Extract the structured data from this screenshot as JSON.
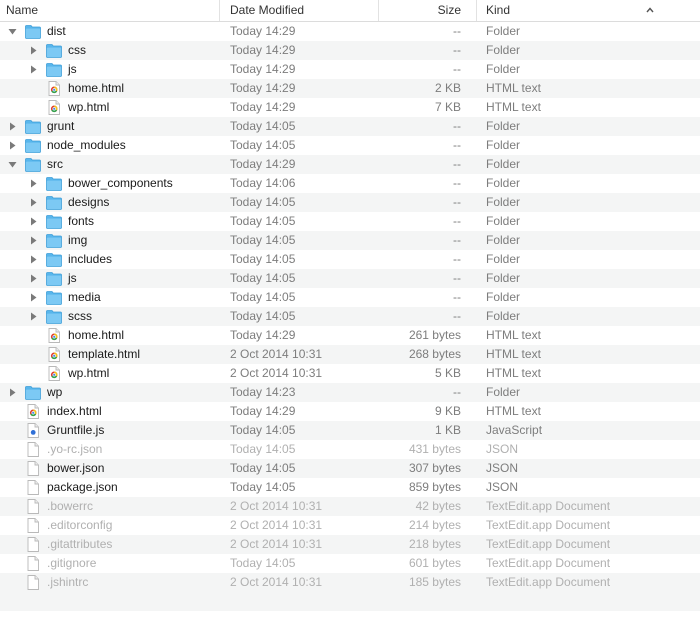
{
  "header": {
    "name_label": "Name",
    "date_label": "Date Modified",
    "size_label": "Size",
    "kind_label": "Kind",
    "sort_icon": "chevron-up-icon"
  },
  "rows": [
    {
      "name": "dist",
      "date": "Today 14:29",
      "size": "--",
      "kind": "Folder",
      "icon": "folder",
      "depth": 0,
      "disclosure": "open",
      "dim": false
    },
    {
      "name": "css",
      "date": "Today 14:29",
      "size": "--",
      "kind": "Folder",
      "icon": "folder",
      "depth": 1,
      "disclosure": "closed",
      "dim": false
    },
    {
      "name": "js",
      "date": "Today 14:29",
      "size": "--",
      "kind": "Folder",
      "icon": "folder",
      "depth": 1,
      "disclosure": "closed",
      "dim": false
    },
    {
      "name": "home.html",
      "date": "Today 14:29",
      "size": "2 KB",
      "kind": "HTML text",
      "icon": "html-file",
      "depth": 1,
      "disclosure": "none",
      "dim": false
    },
    {
      "name": "wp.html",
      "date": "Today 14:29",
      "size": "7 KB",
      "kind": "HTML text",
      "icon": "html-file",
      "depth": 1,
      "disclosure": "none",
      "dim": false
    },
    {
      "name": "grunt",
      "date": "Today 14:05",
      "size": "--",
      "kind": "Folder",
      "icon": "folder",
      "depth": 0,
      "disclosure": "closed",
      "dim": false
    },
    {
      "name": "node_modules",
      "date": "Today 14:05",
      "size": "--",
      "kind": "Folder",
      "icon": "folder",
      "depth": 0,
      "disclosure": "closed",
      "dim": false
    },
    {
      "name": "src",
      "date": "Today 14:29",
      "size": "--",
      "kind": "Folder",
      "icon": "folder",
      "depth": 0,
      "disclosure": "open",
      "dim": false
    },
    {
      "name": "bower_components",
      "date": "Today 14:06",
      "size": "--",
      "kind": "Folder",
      "icon": "folder",
      "depth": 1,
      "disclosure": "closed",
      "dim": false
    },
    {
      "name": "designs",
      "date": "Today 14:05",
      "size": "--",
      "kind": "Folder",
      "icon": "folder",
      "depth": 1,
      "disclosure": "closed",
      "dim": false
    },
    {
      "name": "fonts",
      "date": "Today 14:05",
      "size": "--",
      "kind": "Folder",
      "icon": "folder",
      "depth": 1,
      "disclosure": "closed",
      "dim": false
    },
    {
      "name": "img",
      "date": "Today 14:05",
      "size": "--",
      "kind": "Folder",
      "icon": "folder",
      "depth": 1,
      "disclosure": "closed",
      "dim": false
    },
    {
      "name": "includes",
      "date": "Today 14:05",
      "size": "--",
      "kind": "Folder",
      "icon": "folder",
      "depth": 1,
      "disclosure": "closed",
      "dim": false
    },
    {
      "name": "js",
      "date": "Today 14:05",
      "size": "--",
      "kind": "Folder",
      "icon": "folder",
      "depth": 1,
      "disclosure": "closed",
      "dim": false
    },
    {
      "name": "media",
      "date": "Today 14:05",
      "size": "--",
      "kind": "Folder",
      "icon": "folder",
      "depth": 1,
      "disclosure": "closed",
      "dim": false
    },
    {
      "name": "scss",
      "date": "Today 14:05",
      "size": "--",
      "kind": "Folder",
      "icon": "folder",
      "depth": 1,
      "disclosure": "closed",
      "dim": false
    },
    {
      "name": "home.html",
      "date": "Today 14:29",
      "size": "261 bytes",
      "kind": "HTML text",
      "icon": "html-file",
      "depth": 1,
      "disclosure": "none",
      "dim": false
    },
    {
      "name": "template.html",
      "date": "2 Oct 2014 10:31",
      "size": "268 bytes",
      "kind": "HTML text",
      "icon": "html-file",
      "depth": 1,
      "disclosure": "none",
      "dim": false
    },
    {
      "name": "wp.html",
      "date": "2 Oct 2014 10:31",
      "size": "5 KB",
      "kind": "HTML text",
      "icon": "html-file",
      "depth": 1,
      "disclosure": "none",
      "dim": false
    },
    {
      "name": "wp",
      "date": "Today 14:23",
      "size": "--",
      "kind": "Folder",
      "icon": "folder",
      "depth": 0,
      "disclosure": "closed",
      "dim": false
    },
    {
      "name": "index.html",
      "date": "Today 14:29",
      "size": "9 KB",
      "kind": "HTML text",
      "icon": "html-file",
      "depth": 0,
      "disclosure": "none",
      "dim": false
    },
    {
      "name": "Gruntfile.js",
      "date": "Today 14:05",
      "size": "1 KB",
      "kind": "JavaScript",
      "icon": "js-file",
      "depth": 0,
      "disclosure": "none",
      "dim": false
    },
    {
      "name": ".yo-rc.json",
      "date": "Today 14:05",
      "size": "431 bytes",
      "kind": "JSON",
      "icon": "blank-file",
      "depth": 0,
      "disclosure": "none",
      "dim": true
    },
    {
      "name": "bower.json",
      "date": "Today 14:05",
      "size": "307 bytes",
      "kind": "JSON",
      "icon": "blank-file",
      "depth": 0,
      "disclosure": "none",
      "dim": false
    },
    {
      "name": "package.json",
      "date": "Today 14:05",
      "size": "859 bytes",
      "kind": "JSON",
      "icon": "blank-file",
      "depth": 0,
      "disclosure": "none",
      "dim": false
    },
    {
      "name": ".bowerrc",
      "date": "2 Oct 2014 10:31",
      "size": "42 bytes",
      "kind": "TextEdit.app Document",
      "icon": "blank-file",
      "depth": 0,
      "disclosure": "none",
      "dim": true
    },
    {
      "name": ".editorconfig",
      "date": "2 Oct 2014 10:31",
      "size": "214 bytes",
      "kind": "TextEdit.app Document",
      "icon": "blank-file",
      "depth": 0,
      "disclosure": "none",
      "dim": true
    },
    {
      "name": ".gitattributes",
      "date": "2 Oct 2014 10:31",
      "size": "218 bytes",
      "kind": "TextEdit.app Document",
      "icon": "blank-file",
      "depth": 0,
      "disclosure": "none",
      "dim": true
    },
    {
      "name": ".gitignore",
      "date": "Today 14:05",
      "size": "601 bytes",
      "kind": "TextEdit.app Document",
      "icon": "blank-file",
      "depth": 0,
      "disclosure": "none",
      "dim": true
    },
    {
      "name": ".jshintrc",
      "date": "2 Oct 2014 10:31",
      "size": "185 bytes",
      "kind": "TextEdit.app Document",
      "icon": "blank-file",
      "depth": 0,
      "disclosure": "none",
      "dim": true
    }
  ]
}
